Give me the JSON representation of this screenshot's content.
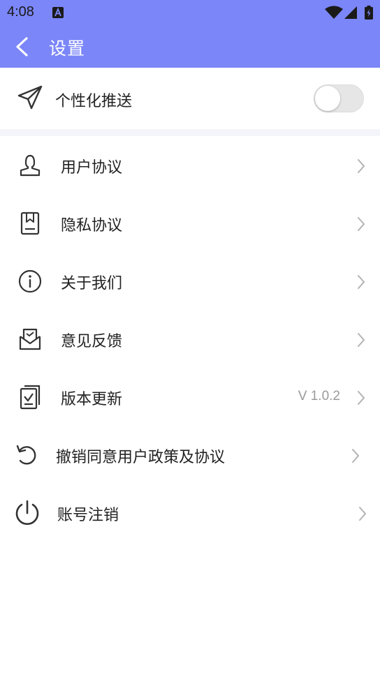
{
  "status_bar": {
    "time": "4:08"
  },
  "app_bar": {
    "title": "设置"
  },
  "push": {
    "label": "个性化推送",
    "enabled": false
  },
  "menu": {
    "items": [
      {
        "label": "用户协议",
        "icon": "user-icon",
        "value": ""
      },
      {
        "label": "隐私协议",
        "icon": "document-icon",
        "value": ""
      },
      {
        "label": "关于我们",
        "icon": "info-icon",
        "value": ""
      },
      {
        "label": "意见反馈",
        "icon": "feedback-mail-icon",
        "value": ""
      },
      {
        "label": "版本更新",
        "icon": "update-icon",
        "value": "V 1.0.2"
      },
      {
        "label": "撤销同意用户政策及协议",
        "icon": "revoke-icon",
        "value": ""
      },
      {
        "label": "账号注销",
        "icon": "power-icon",
        "value": ""
      }
    ]
  },
  "colors": {
    "accent": "#7b86f8",
    "toggle_off": "#e6e6e6",
    "chevron": "#b3b3b3"
  }
}
